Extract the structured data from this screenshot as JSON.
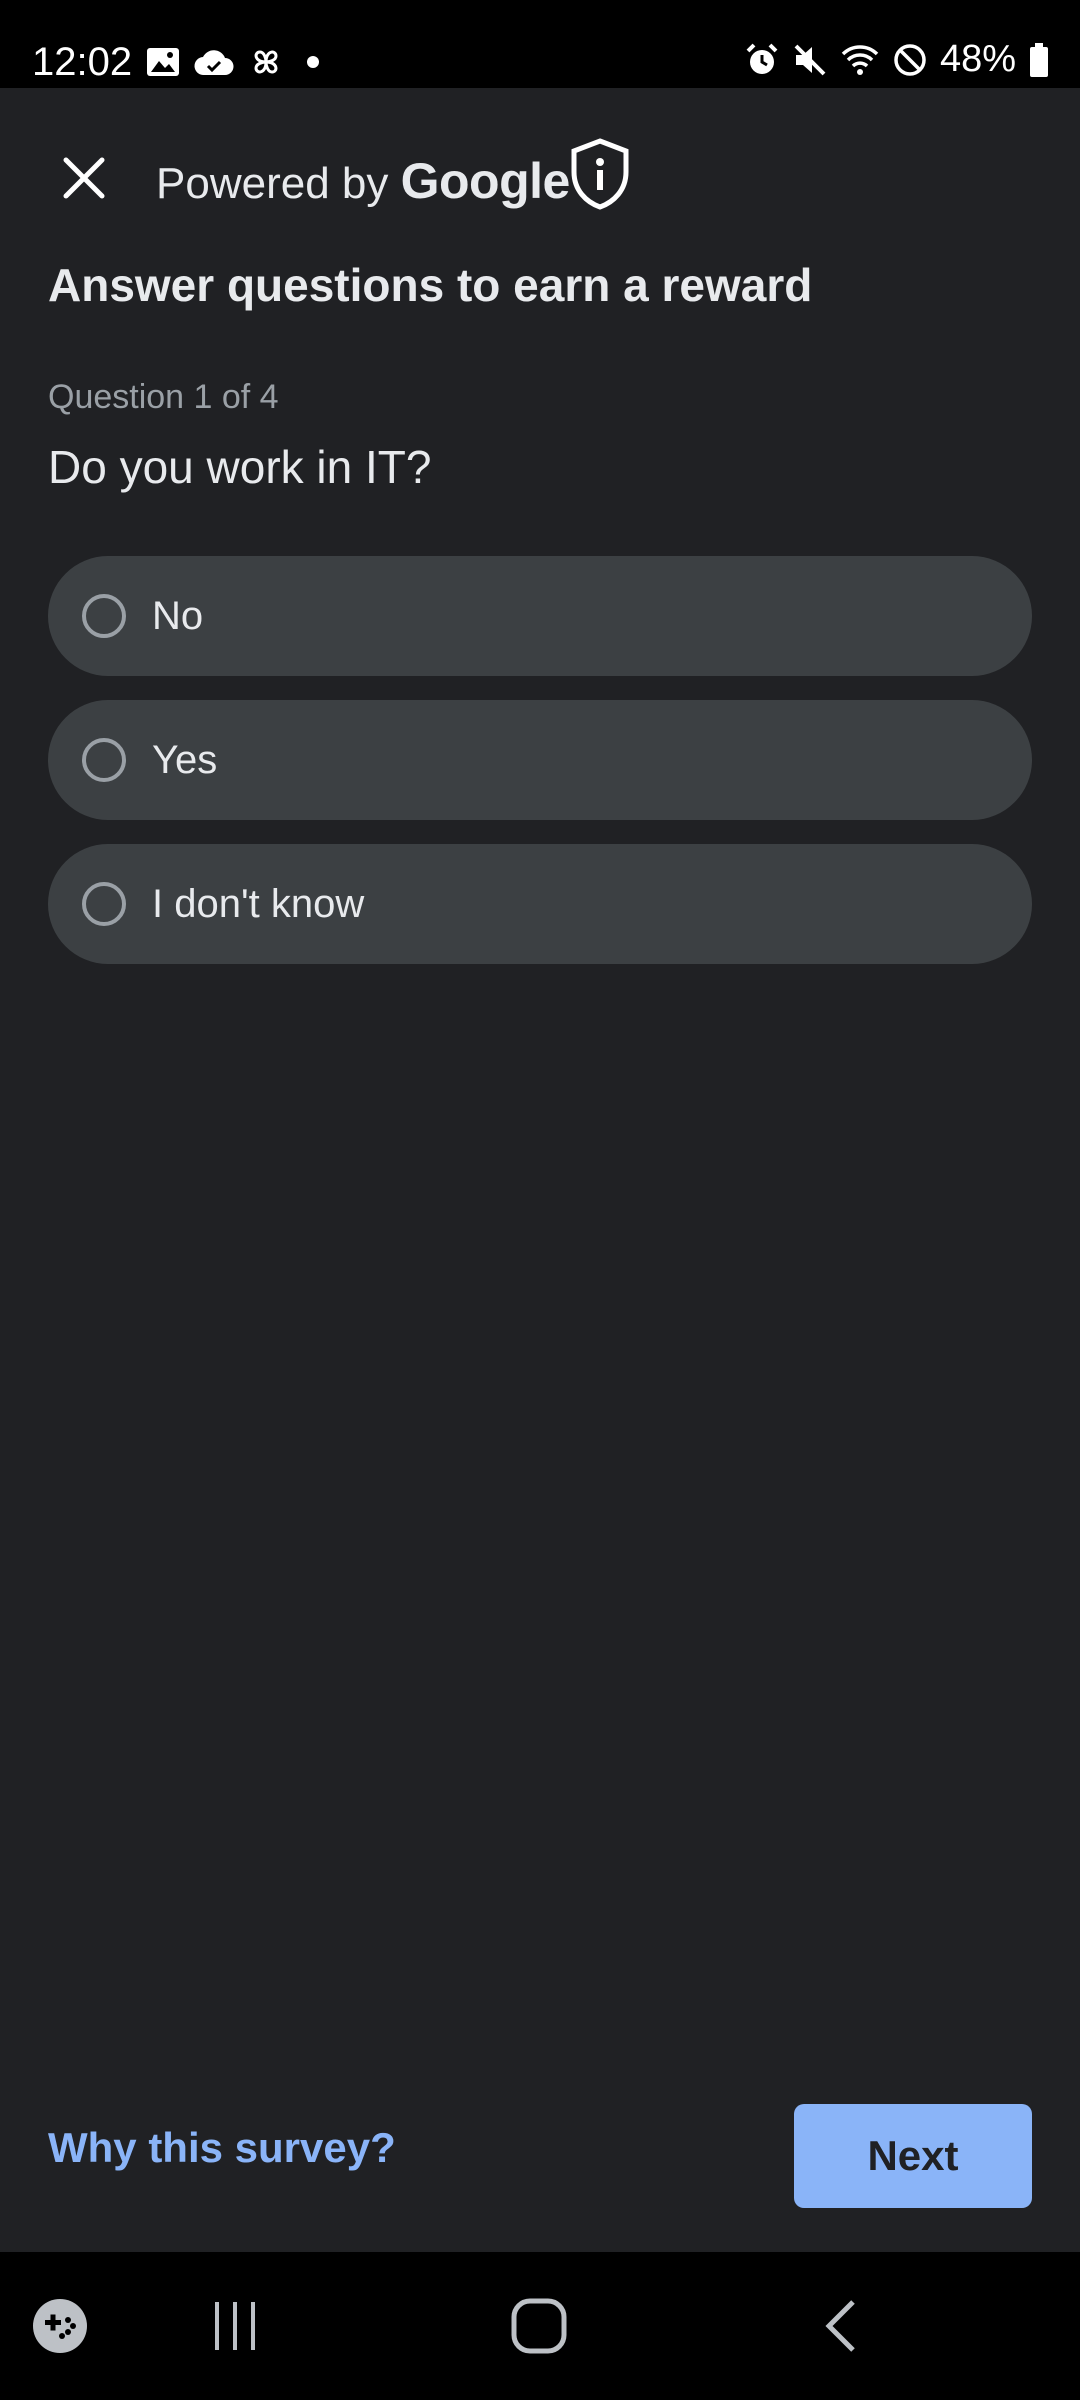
{
  "status_bar": {
    "time": "12:02",
    "battery_percent": "48%",
    "left_icons": [
      "gallery-icon",
      "cloud-icon",
      "pinwheel-icon",
      "dot-icon"
    ],
    "right_icons": [
      "alarm-icon",
      "mute-icon",
      "wifi-icon",
      "do-not-disturb-icon",
      "battery-icon"
    ]
  },
  "header": {
    "powered_prefix": "Powered by",
    "brand": "Google"
  },
  "survey": {
    "title": "Answer questions to earn a reward",
    "question_counter": "Question 1 of 4",
    "question": "Do you work in IT?",
    "options": [
      {
        "label": "No",
        "selected": false
      },
      {
        "label": "Yes",
        "selected": false
      },
      {
        "label": "I don't know",
        "selected": false
      }
    ]
  },
  "footer": {
    "why_link": "Why this survey?",
    "next_label": "Next"
  },
  "colors": {
    "background": "#202124",
    "option_bg": "#3c4043",
    "accent": "#8ab4f8"
  }
}
